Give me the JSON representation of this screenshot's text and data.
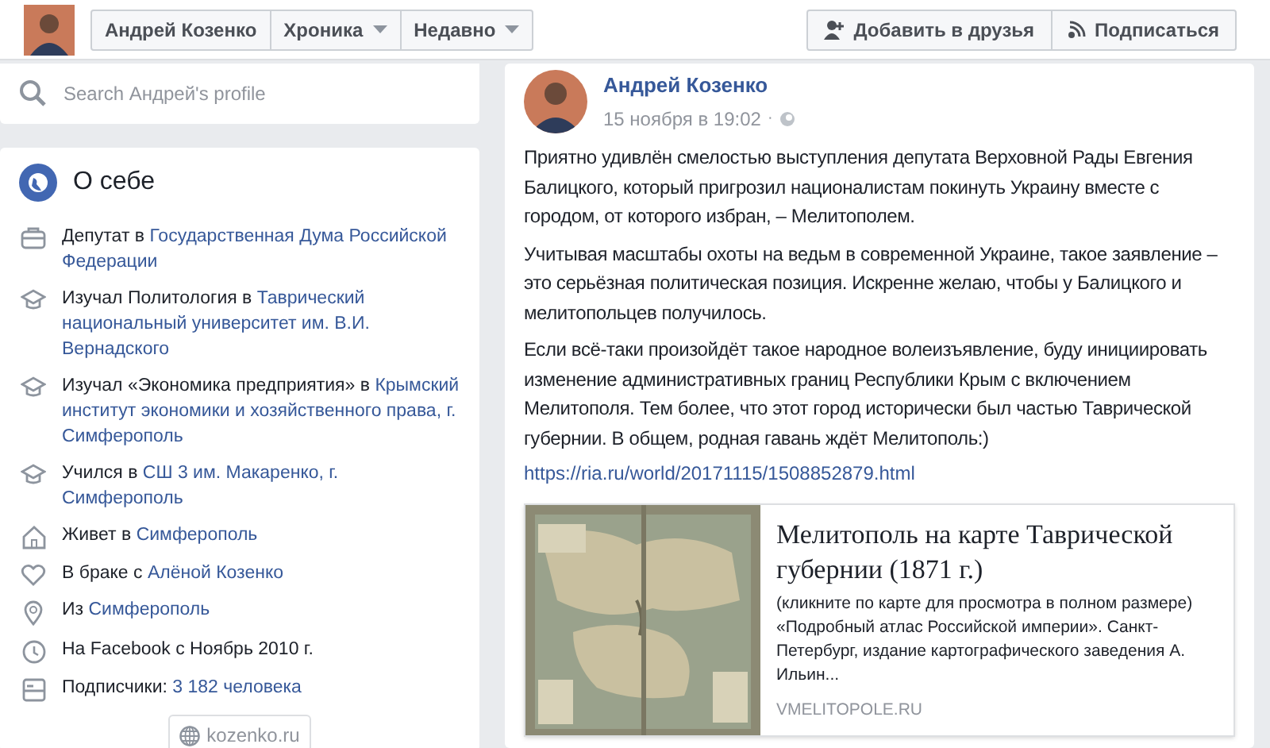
{
  "header": {
    "tabs": [
      {
        "label": "Андрей Козенко",
        "caret": false
      },
      {
        "label": "Хроника",
        "caret": true
      },
      {
        "label": "Недавно",
        "caret": true
      }
    ],
    "buttons": [
      {
        "label": "Добавить в друзья",
        "kind": "add"
      },
      {
        "label": "Подписаться",
        "kind": "follow"
      }
    ]
  },
  "search": {
    "placeholder": "Search Андрей's profile"
  },
  "about": {
    "title": "О себе",
    "items": [
      {
        "kind": "work",
        "parts": [
          {
            "text": "Депутат в ",
            "link": false
          },
          {
            "text": "Государственная Дума Российской Федерации",
            "link": true
          }
        ]
      },
      {
        "kind": "education",
        "parts": [
          {
            "text": "Изучал Политология в ",
            "link": false
          },
          {
            "text": "Таврический национальный университет им. В.И. Вернадского",
            "link": true
          }
        ]
      },
      {
        "kind": "education",
        "parts": [
          {
            "text": "Изучал «Экономика предприятия» в ",
            "link": false
          },
          {
            "text": "Крымский институт экономики и хозяйственного права, г. Симферополь",
            "link": true
          }
        ]
      },
      {
        "kind": "education",
        "parts": [
          {
            "text": "Учился в ",
            "link": false
          },
          {
            "text": "СШ 3 им. Макаренко, г. Симферополь",
            "link": true
          }
        ]
      },
      {
        "kind": "home",
        "parts": [
          {
            "text": "Живет в ",
            "link": false
          },
          {
            "text": "Симферополь",
            "link": true
          }
        ]
      },
      {
        "kind": "relationship",
        "parts": [
          {
            "text": "В браке с ",
            "link": false
          },
          {
            "text": "Алёной Козенко",
            "link": true
          }
        ]
      },
      {
        "kind": "location",
        "parts": [
          {
            "text": "Из ",
            "link": false
          },
          {
            "text": "Симферополь",
            "link": true
          }
        ]
      },
      {
        "kind": "joined",
        "parts": [
          {
            "text": "На Facebook с Ноябрь 2010 г.",
            "link": false
          }
        ]
      },
      {
        "kind": "followers",
        "parts": [
          {
            "text": "Подписчики: ",
            "link": false
          },
          {
            "text": "3 182 человека",
            "link": true
          }
        ]
      }
    ],
    "website": "kozenko.ru"
  },
  "post": {
    "author": "Андрей Козенко",
    "time": "15 ноября в 19:02",
    "time_separator": "·",
    "paragraphs": [
      "Приятно удивлён смелостью выступления депутата Верховной Рады Евгения Балицкого, который пригрозил националистам покинуть Украину вместе с городом, от которого избран, – Мелитополем.",
      "Учитывая масштабы охоты на ведьм в современной Украине, такое заявление – это серьёзная политическая позиция. Искренне желаю, чтобы у Балицкого и мелитопольцев получилось.",
      "Если всё-таки произойдёт такое народное волеизъявление, буду инициировать изменение административных границ Республики Крым с включением Мелитополя. Тем более, что этот город исторически был частью Таврической губернии. В общем, родная гавань ждёт Мелитополь:)"
    ],
    "link": "https://ria.ru/world/20171115/1508852879.html",
    "preview": {
      "title": "Мелитополь на карте Таврической губернии (1871 г.)",
      "description": "(кликните по карте для просмотра в полном размере) «Подробный атлас Российской империи». Санкт-Петербург, издание картографического заведения А. Ильин...",
      "domain": "VMELITOPOLE.RU"
    }
  }
}
